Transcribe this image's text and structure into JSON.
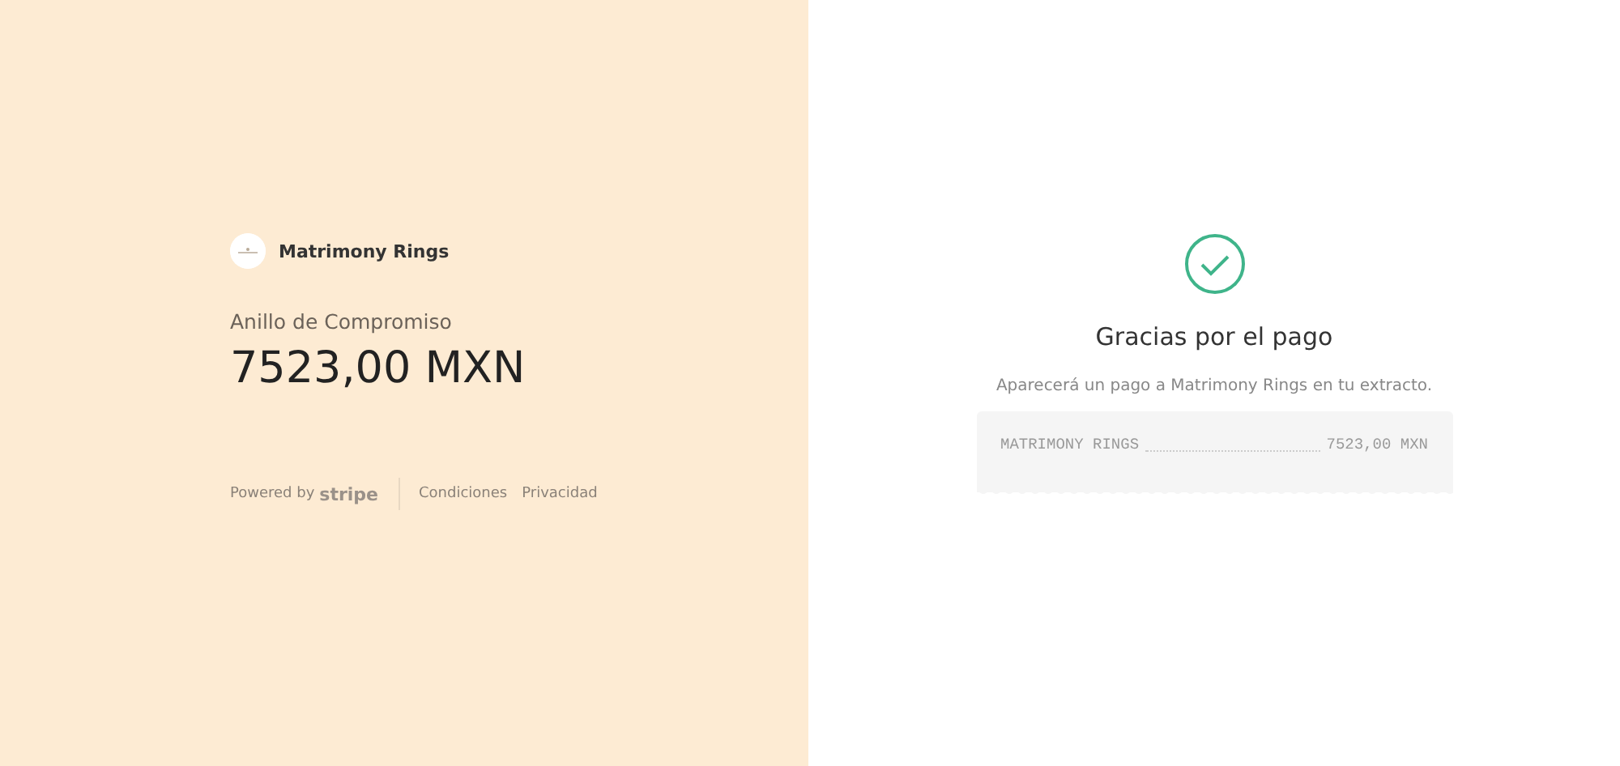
{
  "merchant": {
    "name": "Matrimony Rings"
  },
  "product": {
    "name": "Anillo de Compromiso",
    "amount": "7523,00 MXN"
  },
  "footer": {
    "powered_by": "Powered by",
    "brand": "stripe",
    "links": [
      "Condiciones",
      "Privacidad"
    ]
  },
  "confirmation": {
    "paid": true,
    "title": "Gracias por el pago",
    "message": "Aparecerá un pago a Matrimony Rings en tu extracto.",
    "receipt": {
      "descriptor": "MATRIMONY RINGS",
      "amount": "7523,00 MXN"
    }
  }
}
